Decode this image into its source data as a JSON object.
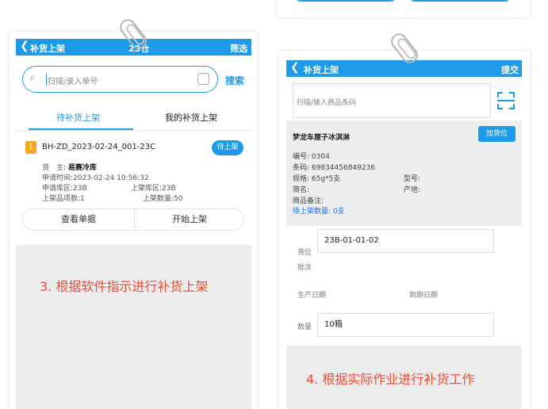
{
  "left": {
    "header": {
      "back_glyph": "❮",
      "title": "补货上架",
      "warehouse": "23仓",
      "filter": "筛选"
    },
    "search": {
      "placeholder": "扫描/录入单号",
      "button": "搜索"
    },
    "tabs": [
      {
        "label": "待补货上架"
      },
      {
        "label": "我的补货上架"
      }
    ],
    "order": {
      "index": "1",
      "code": "BH-ZD_2023-02-24_001-23C",
      "status": "待上架",
      "owner_label": "货　主:",
      "owner_value": "易赛冷库",
      "apply_time": "申请时间:2023-02-24 10:56:32",
      "apply_area": "申请库区:23B",
      "shelf_area": "上架库区:23B",
      "item_count": "上架品项数:1",
      "shelf_qty": "上架数量:50"
    },
    "actions": {
      "view": "查看单据",
      "start": "开始上架"
    },
    "caption": "3. 根据软件指示进行补货上架"
  },
  "right": {
    "header": {
      "back_glyph": "❮",
      "title": "补货上架",
      "submit": "提交"
    },
    "input_placeholder": "扫描/输入商品条码",
    "product": {
      "name": "梦龙车厘子冰淇淋",
      "add_location": "加货位",
      "code": "编号: 0304",
      "barcode": "条码: 69834456849236",
      "spec": "规格: 65g*5支",
      "model": "型号:",
      "short_name": "简名:",
      "origin": "产地:",
      "remark": "商品备注:",
      "pending_qty": "待上架数量: 0支"
    },
    "form": {
      "location_label": "货位",
      "location_value": "23B-01-01-02",
      "batch_label": "批次",
      "mfg_label": "生产日期",
      "exp_label": "到期日期",
      "qty_label": "数量",
      "qty_value": "10箱"
    },
    "caption": "4. 根据实际作业进行补货工作"
  },
  "colors": {
    "accent": "#1e9be8",
    "caption": "#e8503a",
    "badge_orange": "#f5a623"
  },
  "icons": [
    "back-icon",
    "search-icon",
    "scan-icon",
    "paperclip-icon"
  ]
}
